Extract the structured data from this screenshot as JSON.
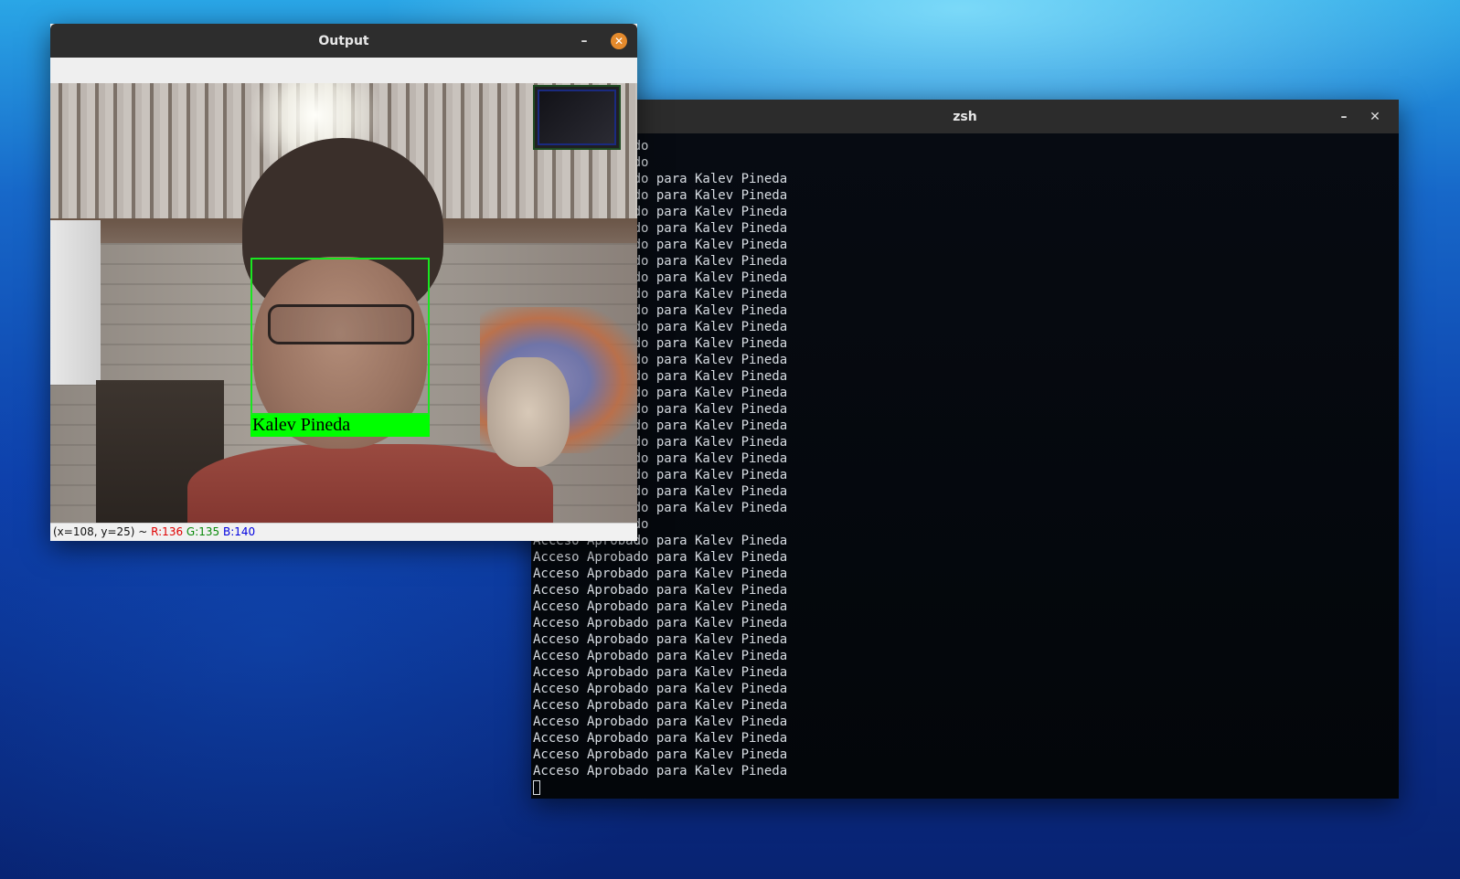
{
  "terminal": {
    "title": "zsh",
    "minimize_glyph": "–",
    "close_glyph": "✕",
    "lines": [
      "Acceso Aprobado",
      "Acceso Aprobado",
      "Acceso Aprobado para Kalev Pineda",
      "Acceso Aprobado para Kalev Pineda",
      "Acceso Aprobado para Kalev Pineda",
      "Acceso Aprobado para Kalev Pineda",
      "Acceso Aprobado para Kalev Pineda",
      "Acceso Aprobado para Kalev Pineda",
      "Acceso Aprobado para Kalev Pineda",
      "Acceso Aprobado para Kalev Pineda",
      "Acceso Aprobado para Kalev Pineda",
      "Acceso Aprobado para Kalev Pineda",
      "Acceso Aprobado para Kalev Pineda",
      "Acceso Aprobado para Kalev Pineda",
      "Acceso Aprobado para Kalev Pineda",
      "Acceso Aprobado para Kalev Pineda",
      "Acceso Aprobado para Kalev Pineda",
      "Acceso Aprobado para Kalev Pineda",
      "Acceso Aprobado para Kalev Pineda",
      "Acceso Aprobado para Kalev Pineda",
      "Acceso Aprobado para Kalev Pineda",
      "Acceso Aprobado para Kalev Pineda",
      "Acceso Aprobado para Kalev Pineda",
      "Acceso Aprobado",
      "Acceso Aprobado para Kalev Pineda",
      "Acceso Aprobado para Kalev Pineda",
      "Acceso Aprobado para Kalev Pineda",
      "Acceso Aprobado para Kalev Pineda",
      "Acceso Aprobado para Kalev Pineda",
      "Acceso Aprobado para Kalev Pineda",
      "Acceso Aprobado para Kalev Pineda",
      "Acceso Aprobado para Kalev Pineda",
      "Acceso Aprobado para Kalev Pineda",
      "Acceso Aprobado para Kalev Pineda",
      "Acceso Aprobado para Kalev Pineda",
      "Acceso Aprobado para Kalev Pineda",
      "Acceso Aprobado para Kalev Pineda",
      "Acceso Aprobado para Kalev Pineda",
      "Acceso Aprobado para Kalev Pineda"
    ]
  },
  "output_window": {
    "title": "Output",
    "minimize_glyph": "–",
    "close_glyph": "✕",
    "face_label": "Kalev Pineda",
    "box_color": "#00ff00",
    "status": {
      "coords": "(x=108, y=25) ~ ",
      "r": "R:136",
      "g": "G:135",
      "b": "B:140",
      "r_color": "#e00000",
      "g_color": "#0a8a0a",
      "b_color": "#0000e0"
    }
  }
}
